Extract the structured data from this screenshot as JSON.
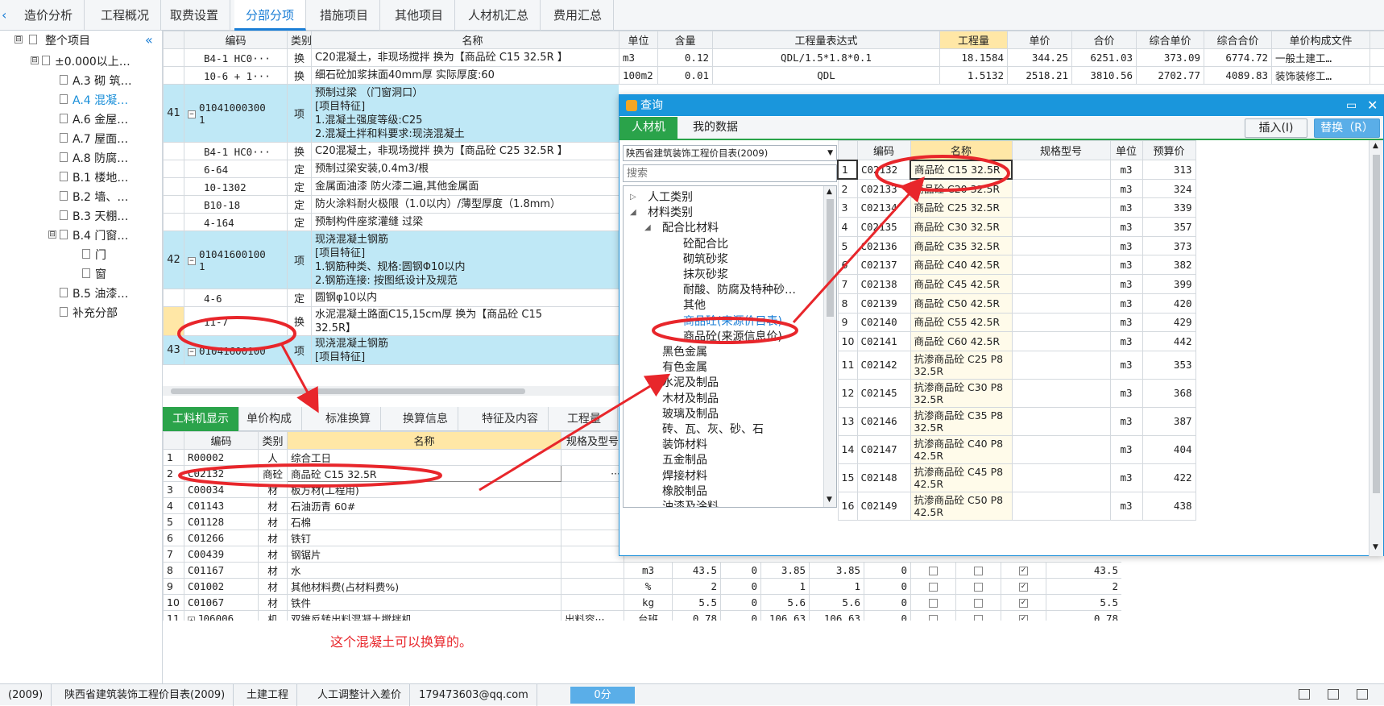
{
  "top_tabs": [
    "造价分析",
    "工程概况",
    "取费设置",
    "分部分项",
    "措施项目",
    "其他项目",
    "人材机汇总",
    "费用汇总"
  ],
  "tree": {
    "root": "整个项目",
    "items": [
      {
        "label": "±0.000以上…",
        "level": 1,
        "box": "⊟"
      },
      {
        "label": "A.3  砌 筑…",
        "level": 2
      },
      {
        "label": "A.4  混凝…",
        "level": 2,
        "active": true
      },
      {
        "label": "A.6  金屋…",
        "level": 2
      },
      {
        "label": "A.7  屋面…",
        "level": 2
      },
      {
        "label": "A.8  防腐…",
        "level": 2
      },
      {
        "label": "B.1  楼地…",
        "level": 2
      },
      {
        "label": "B.2  墙、…",
        "level": 2
      },
      {
        "label": "B.3  天棚…",
        "level": 2
      },
      {
        "label": "B.4  门窗…",
        "level": 2,
        "box": "⊟"
      },
      {
        "label": "门",
        "level": 3
      },
      {
        "label": "窗",
        "level": 3
      },
      {
        "label": "B.5  油漆…",
        "level": 2
      },
      {
        "label": "补充分部",
        "level": 2
      }
    ]
  },
  "main_grid": {
    "headers": [
      "编码",
      "类别",
      "名称",
      "单位",
      "含量",
      "工程量表达式",
      "工程量",
      "单价",
      "合价",
      "综合单价",
      "综合合价",
      "单价构成文件"
    ],
    "rows": [
      {
        "num": "",
        "code": "B4-1 HC0···",
        "type": "换",
        "name": "C20混凝土，非现场搅拌  换为【商品砼 C15 32.5R 】",
        "unit": "m3",
        "qty_ratio": "0.12",
        "expr": "QDL/1.5*1.8*0.1",
        "qty": "18.1584",
        "price": "344.25",
        "total": "6251.03",
        "cprice": "373.09",
        "ctotal": "6774.72",
        "file": "一般土建工…"
      },
      {
        "num": "",
        "code": "10-6 + 1···",
        "type": "换",
        "name": "细石砼加浆抹面40mm厚  实际厚度:60",
        "unit": "100m2",
        "qty_ratio": "0.01",
        "expr": "QDL",
        "qty": "1.5132",
        "price": "2518.21",
        "total": "3810.56",
        "cprice": "2702.77",
        "ctotal": "4089.83",
        "file": "装饰装修工…"
      },
      {
        "num": "41",
        "code": "01041000300\n1",
        "type": "项",
        "name": "预制过梁 （门窗洞口）\n[项目特征]\n1.混凝土强度等级:C25\n2.混凝土拌和料要求:现浇混凝土",
        "blue": true
      },
      {
        "num": "",
        "code": "B4-1 HC0···",
        "type": "换",
        "name": "C20混凝土，非现场搅拌  换为【商品砼 C25 32.5R 】"
      },
      {
        "num": "",
        "code": "6-64",
        "type": "定",
        "name": "预制过梁安装,0.4m3/根"
      },
      {
        "num": "",
        "code": "10-1302",
        "type": "定",
        "name": "金属面油漆 防火漆二遍,其他金属面"
      },
      {
        "num": "",
        "code": "B10-18",
        "type": "定",
        "name": "防火涂料耐火极限（1.0以内）/薄型厚度（1.8mm）"
      },
      {
        "num": "",
        "code": "4-164",
        "type": "定",
        "name": "预制构件座浆灌缝 过梁"
      },
      {
        "num": "42",
        "code": "01041600100\n1",
        "type": "项",
        "name": "现浇混凝土钢筋\n[项目特征]\n1.钢筋种类、规格:圆钢Φ10以内\n2.钢筋连接: 按图纸设计及规范",
        "blue": true
      },
      {
        "num": "",
        "code": "4-6",
        "type": "定",
        "name": "圆钢φ10以内"
      },
      {
        "num": "",
        "code": "11-7",
        "type": "换",
        "name": "水泥混凝土路面C15,15cm厚  换为【商品砼 C15\n32.5R】"
      },
      {
        "num": "43",
        "code": "01041600100",
        "type": "项",
        "name": "现浇混凝土钢筋\n[项目特征]",
        "blue": true
      }
    ]
  },
  "bottom_tabs": [
    "工料机显示",
    "单价构成",
    "标准换算",
    "换算信息",
    "特征及内容",
    "工程量明"
  ],
  "bottom_grid": {
    "headers": [
      "编码",
      "类别",
      "名称",
      "规格及型号"
    ],
    "rows": [
      {
        "num": "1",
        "code": "R00002",
        "type": "人",
        "name": "综合工日",
        "spec": ""
      },
      {
        "num": "2",
        "code": "C02132",
        "type": "商砼",
        "name": "商品砼 C15 32.5R",
        "spec": "···"
      },
      {
        "num": "3",
        "code": "C00034",
        "type": "材",
        "name": "板方材(工程用)",
        "spec": ""
      },
      {
        "num": "4",
        "code": "C01143",
        "type": "材",
        "name": "石油沥青 60#",
        "spec": ""
      },
      {
        "num": "5",
        "code": "C01128",
        "type": "材",
        "name": "石棉",
        "spec": ""
      },
      {
        "num": "6",
        "code": "C01266",
        "type": "材",
        "name": "铁钉",
        "spec": ""
      },
      {
        "num": "7",
        "code": "C00439",
        "type": "材",
        "name": "钢锯片",
        "spec": ""
      },
      {
        "num": "8",
        "code": "C01167",
        "type": "材",
        "name": "水",
        "spec": "",
        "unit": "m3",
        "v1": "43.5",
        "v2": "0",
        "v3": "3.85",
        "v4": "3.85",
        "v5": "0",
        "c3": true,
        "v6": "43.5"
      },
      {
        "num": "9",
        "code": "C01002",
        "type": "材",
        "name": "其他材料费(占材料费%)",
        "spec": "",
        "unit": "%",
        "v1": "2",
        "v2": "0",
        "v3": "1",
        "v4": "1",
        "v5": "0",
        "c3": true,
        "v6": "2"
      },
      {
        "num": "10",
        "code": "C01067",
        "type": "材",
        "name": "铁件",
        "spec": "",
        "unit": "kg",
        "v1": "5.5",
        "v2": "0",
        "v3": "5.6",
        "v4": "5.6",
        "v5": "0",
        "c3": true,
        "v6": "5.5"
      },
      {
        "num": "11",
        "code": "J06006",
        "type": "机",
        "name": "双锥反转出料混凝土搅拌机",
        "spec": "出料容···",
        "unit": "台班",
        "v1": "0.78",
        "v2": "0",
        "v3": "106.63",
        "v4": "106.63",
        "v5": "0",
        "c3": true,
        "v6": "0.78"
      }
    ]
  },
  "annotation": "这个混凝土可以换算的。",
  "dialog": {
    "title": "查询",
    "tabs": [
      "人材机",
      "我的数据"
    ],
    "insert_btn": "插入(I)",
    "replace_btn": "替换（R）",
    "catalog": "陕西省建筑装饰工程价目表(2009)",
    "search_placeholder": "搜索",
    "tree": [
      {
        "label": "人工类别",
        "level": 0,
        "arrow": "▷"
      },
      {
        "label": "材料类别",
        "level": 0,
        "arrow": "◢"
      },
      {
        "label": "配合比材料",
        "level": 1,
        "arrow": "◢"
      },
      {
        "label": "砼配合比",
        "level": 2
      },
      {
        "label": "砌筑砂浆",
        "level": 2
      },
      {
        "label": "抹灰砂浆",
        "level": 2
      },
      {
        "label": "耐酸、防腐及特种砂…",
        "level": 2
      },
      {
        "label": "其他",
        "level": 2
      },
      {
        "label": "商品砼(来源价目表)",
        "level": 2,
        "selected": true
      },
      {
        "label": "商品砼(来源信息价)",
        "level": 2
      },
      {
        "label": "黑色金属",
        "level": 1
      },
      {
        "label": "有色金属",
        "level": 1
      },
      {
        "label": "水泥及制品",
        "level": 1
      },
      {
        "label": "木材及制品",
        "level": 1
      },
      {
        "label": "玻璃及制品",
        "level": 1
      },
      {
        "label": "砖、瓦、灰、砂、石",
        "level": 1
      },
      {
        "label": "装饰材料",
        "level": 1
      },
      {
        "label": "五金制品",
        "level": 1
      },
      {
        "label": "焊接材料",
        "level": 1
      },
      {
        "label": "橡胶制品",
        "level": 1
      },
      {
        "label": "油漆及涂料",
        "level": 1
      },
      {
        "label": "化工材料",
        "level": 1
      }
    ],
    "grid_headers": [
      "编码",
      "名称",
      "规格型号",
      "单位",
      "预算价"
    ],
    "grid_rows": [
      {
        "num": "1",
        "code": "C02132",
        "name": "商品砼 C15 32.5R",
        "unit": "m3",
        "price": "313"
      },
      {
        "num": "2",
        "code": "C02133",
        "name": "商品砼 C20 32.5R",
        "unit": "m3",
        "price": "324"
      },
      {
        "num": "3",
        "code": "C02134",
        "name": "商品砼 C25 32.5R",
        "unit": "m3",
        "price": "339"
      },
      {
        "num": "4",
        "code": "C02135",
        "name": "商品砼 C30 32.5R",
        "unit": "m3",
        "price": "357"
      },
      {
        "num": "5",
        "code": "C02136",
        "name": "商品砼 C35 32.5R",
        "unit": "m3",
        "price": "373"
      },
      {
        "num": "6",
        "code": "C02137",
        "name": "商品砼 C40 42.5R",
        "unit": "m3",
        "price": "382"
      },
      {
        "num": "7",
        "code": "C02138",
        "name": "商品砼 C45 42.5R",
        "unit": "m3",
        "price": "399"
      },
      {
        "num": "8",
        "code": "C02139",
        "name": "商品砼 C50 42.5R",
        "unit": "m3",
        "price": "420"
      },
      {
        "num": "9",
        "code": "C02140",
        "name": "商品砼 C55 42.5R",
        "unit": "m3",
        "price": "429"
      },
      {
        "num": "10",
        "code": "C02141",
        "name": "商品砼 C60 42.5R",
        "unit": "m3",
        "price": "442"
      },
      {
        "num": "11",
        "code": "C02142",
        "name": "抗渗商品砼 C25 P8\n32.5R",
        "unit": "m3",
        "price": "353"
      },
      {
        "num": "12",
        "code": "C02145",
        "name": "抗渗商品砼 C30 P8\n32.5R",
        "unit": "m3",
        "price": "368"
      },
      {
        "num": "13",
        "code": "C02146",
        "name": "抗渗商品砼 C35 P8\n32.5R",
        "unit": "m3",
        "price": "387"
      },
      {
        "num": "14",
        "code": "C02147",
        "name": "抗渗商品砼 C40 P8\n42.5R",
        "unit": "m3",
        "price": "404"
      },
      {
        "num": "15",
        "code": "C02148",
        "name": "抗渗商品砼 C45 P8\n42.5R",
        "unit": "m3",
        "price": "422"
      },
      {
        "num": "16",
        "code": "C02149",
        "name": "抗渗商品砼 C50 P8\n42.5R",
        "unit": "m3",
        "price": "438"
      }
    ]
  },
  "statusbar": [
    "(2009)",
    "陕西省建筑装饰工程价目表(2009)",
    "土建工程",
    "人工调整计入差价",
    "179473603@qq.com",
    "0分"
  ],
  "colors": {
    "accent": "#1a96dc",
    "green": "#2aa34a",
    "highlight": "#bfe8f6",
    "annotation_red": "#e8262b"
  }
}
